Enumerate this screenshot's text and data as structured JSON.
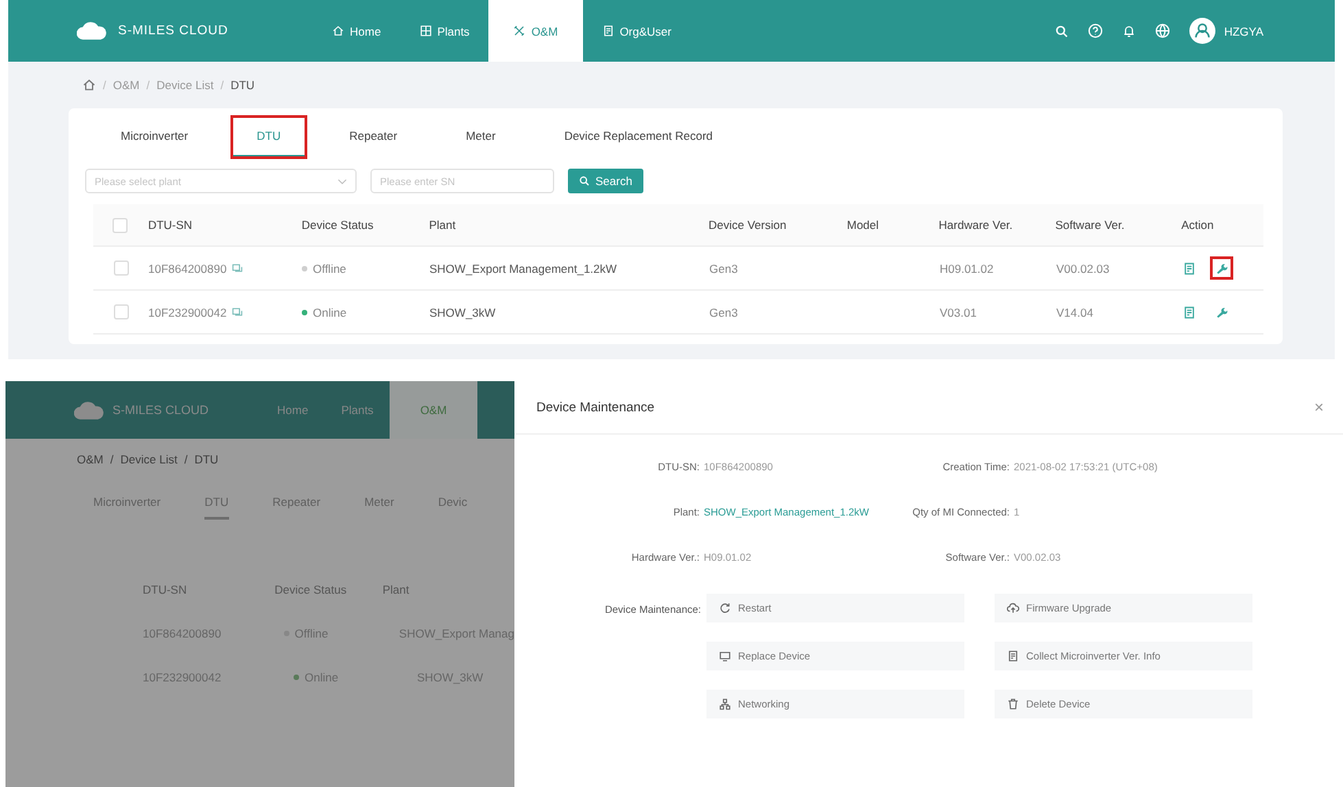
{
  "main_screen": {
    "header": {
      "logo": "S-MILES CLOUD",
      "nav": [
        {
          "label": "Home",
          "selected": false
        },
        {
          "label": "Plants",
          "selected": false
        },
        {
          "label": "O&M",
          "selected": true
        },
        {
          "label": "Org&User",
          "selected": false
        }
      ],
      "user": "HZGYA"
    },
    "breadcrumb": [
      "O&M",
      "Device List",
      "DTU"
    ],
    "breadcrumb_separator": "/",
    "tabs": [
      {
        "label": "Microinverter",
        "selected": false,
        "highlighted": false
      },
      {
        "label": "DTU",
        "selected": true,
        "highlighted": true
      },
      {
        "label": "Repeater",
        "selected": false,
        "highlighted": false
      },
      {
        "label": "Meter",
        "selected": false,
        "highlighted": false
      },
      {
        "label": "Device Replacement Record",
        "selected": false,
        "highlighted": false
      }
    ],
    "filters": {
      "plant_placeholder": "Please select plant",
      "sn_placeholder": "Please enter SN",
      "search_button": "Search"
    },
    "table": {
      "select_all_checked": false,
      "columns": [
        "DTU-SN",
        "Device Status",
        "Plant",
        "Device Version",
        "Model",
        "Hardware Ver.",
        "Software Ver.",
        "Action"
      ],
      "rows": [
        {
          "checked": false,
          "sn": "10F864200890",
          "status": "Offline",
          "online": false,
          "plant": "SHOW_Export Management_1.2kW",
          "version": "Gen3",
          "hardware": "H09.01.02",
          "software": "V00.02.03",
          "maintain_highlighted": true
        },
        {
          "checked": false,
          "sn": "10F232900042",
          "status": "Online",
          "online": true,
          "plant": "SHOW_3kW",
          "version": "Gen3",
          "hardware": "V03.01",
          "software": "V14.04",
          "maintain_highlighted": false
        }
      ]
    }
  },
  "background_screen": {
    "header": {
      "logo": "S-MILES CLOUD",
      "nav": [
        {
          "label": "Home",
          "selected": false
        },
        {
          "label": "Plants",
          "selected": false
        },
        {
          "label": "O&M",
          "selected": true
        }
      ]
    },
    "breadcrumb": [
      "O&M",
      "Device List",
      "DTU"
    ],
    "breadcrumb_separator": "/",
    "tabs": [
      {
        "label": "Microinverter",
        "selected": false
      },
      {
        "label": "DTU",
        "selected": true
      },
      {
        "label": "Repeater",
        "selected": false
      },
      {
        "label": "Meter",
        "selected": false
      },
      {
        "label": "Devic",
        "selected": false
      }
    ],
    "columns": [
      "DTU-SN",
      "Device Status",
      "Plant"
    ],
    "rows": [
      {
        "sn": "10F864200890",
        "status": "Offline",
        "online": false,
        "plant": "SHOW_Export Manag"
      },
      {
        "sn": "10F232900042",
        "status": "Online",
        "online": true,
        "plant": "SHOW_3kW"
      }
    ]
  },
  "drawer": {
    "title": "Device Maintenance",
    "close": "×",
    "fields": [
      {
        "label": "DTU-SN:",
        "value": "10F864200890",
        "kind": "text"
      },
      {
        "label": "Creation Time:",
        "value": "2021-08-02 17:53:21 (UTC+08)",
        "kind": "text"
      },
      {
        "label": "Plant:",
        "value": "SHOW_Export Management_1.2kW",
        "kind": "link"
      },
      {
        "label": "Qty of MI Connected:",
        "value": "1",
        "kind": "text"
      },
      {
        "label": "Hardware Ver.:",
        "value": "H09.01.02",
        "kind": "text"
      },
      {
        "label": "Software Ver.:",
        "value": "V00.02.03",
        "kind": "text"
      }
    ],
    "maintenance_label": "Device Maintenance:",
    "actions": [
      "Restart",
      "Firmware Upgrade",
      "Replace Device",
      "Collect Microinverter Ver. Info",
      "Networking",
      "Delete Device"
    ]
  }
}
